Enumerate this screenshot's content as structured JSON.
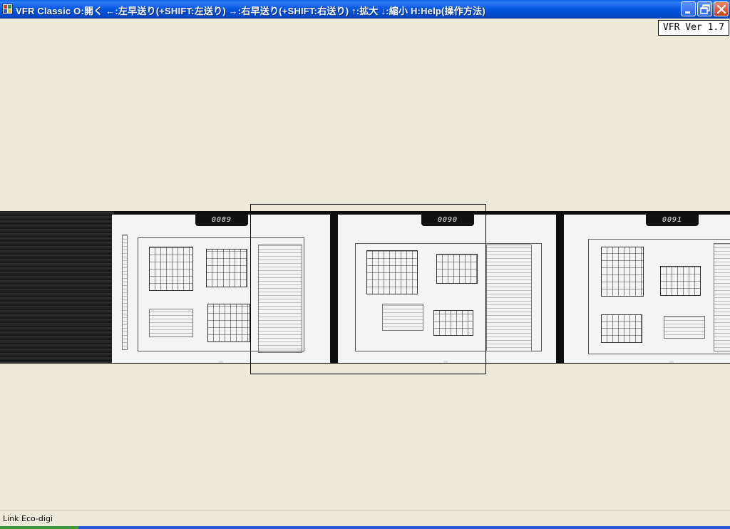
{
  "window": {
    "title": "VFR Classic  O:開く  ←:左早送り(+SHIFT:左送り)  →:右早送り(+SHIFT:右送り)  ↑:拡大  ↓:縮小  H:Help(操作方法)",
    "app_icon": "app-grid-icon",
    "controls": {
      "minimize": "minimize-icon",
      "restore": "restore-icon",
      "close": "close-icon"
    }
  },
  "version_label": "VFR Ver 1.7",
  "film": {
    "frames": [
      {
        "number": "0089"
      },
      {
        "number": "0090"
      },
      {
        "number": "0091"
      }
    ]
  },
  "status": {
    "text": "Link Eco-digi"
  },
  "colors": {
    "titlebar": "#0454e0",
    "background": "#ece9d8",
    "close_button": "#c5401d",
    "film": "#0d0d0d"
  }
}
